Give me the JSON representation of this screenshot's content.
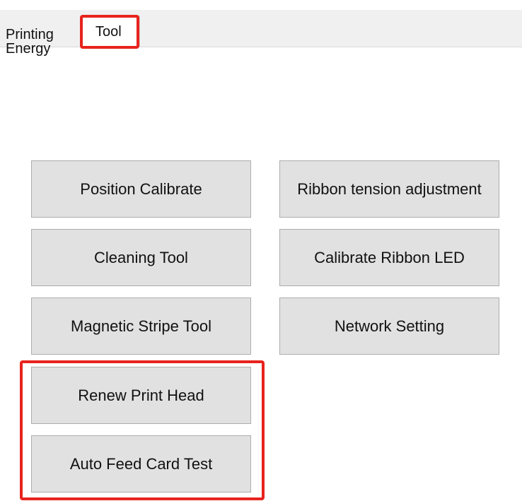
{
  "tabs": [
    {
      "label": "Printing Energy"
    },
    {
      "label": "Tool",
      "selected": true
    }
  ],
  "buttons": {
    "position_calibrate": "Position Calibrate",
    "ribbon_tension": "Ribbon tension adjustment",
    "cleaning_tool": "Cleaning Tool",
    "calibrate_ribbon_led": "Calibrate Ribbon LED",
    "magnetic_stripe_tool": "Magnetic Stripe Tool",
    "network_setting": "Network Setting",
    "renew_print_head": "Renew Print Head",
    "auto_feed_card_test": "Auto Feed Card Test"
  },
  "colors": {
    "highlight": "#e8231d",
    "button_face": "#e1e1e1",
    "button_border": "#adadad",
    "tabstrip": "#f0f0f0"
  }
}
